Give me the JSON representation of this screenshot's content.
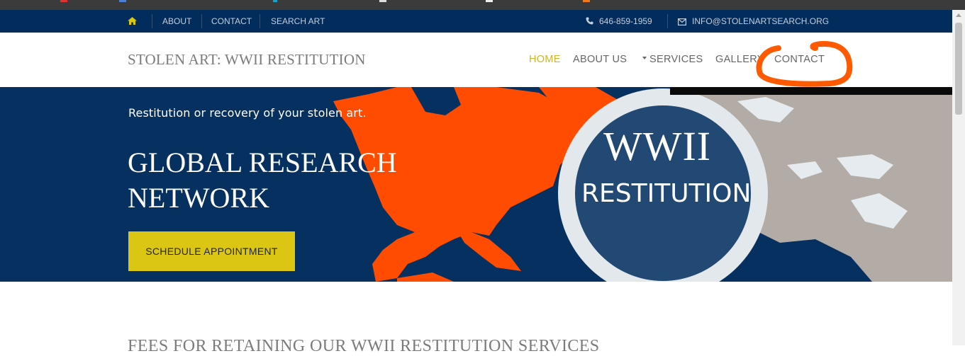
{
  "topbar": {
    "about": "ABOUT",
    "contact": "CONTACT",
    "search_art": "SEARCH ART",
    "phone": "646-859-1959",
    "email": "INFO@STOLENARTSEARCH.ORG"
  },
  "header": {
    "site_title": "STOLEN ART: WWII RESTITUTION",
    "nav": {
      "home": "HOME",
      "about_us": "ABOUT US",
      "services": "SERVICES",
      "gallery": "GALLERY",
      "contact": "CONTACT"
    }
  },
  "hero": {
    "tagline": "Restitution or recovery of your stolen art.",
    "title_line1": "GLOBAL RESEARCH",
    "title_line2": "NETWORK",
    "cta_label": "SCHEDULE APPOINTMENT",
    "badge_line1": "WWII",
    "badge_line2": "RESTITUTION"
  },
  "main": {
    "section_heading": "FEES FOR RETAINING OUR WWII RESTITUTION SERVICES"
  },
  "colors": {
    "topbar_bg": "#022c5b",
    "hero_bg": "#06305f",
    "accent_gold": "#dcc614",
    "nav_active": "#c9b430",
    "map_orange": "#ff4c00",
    "annotation_orange": "#ff5a00"
  },
  "icons": {
    "home": "home-icon",
    "phone": "phone-icon",
    "email": "envelope-icon"
  }
}
